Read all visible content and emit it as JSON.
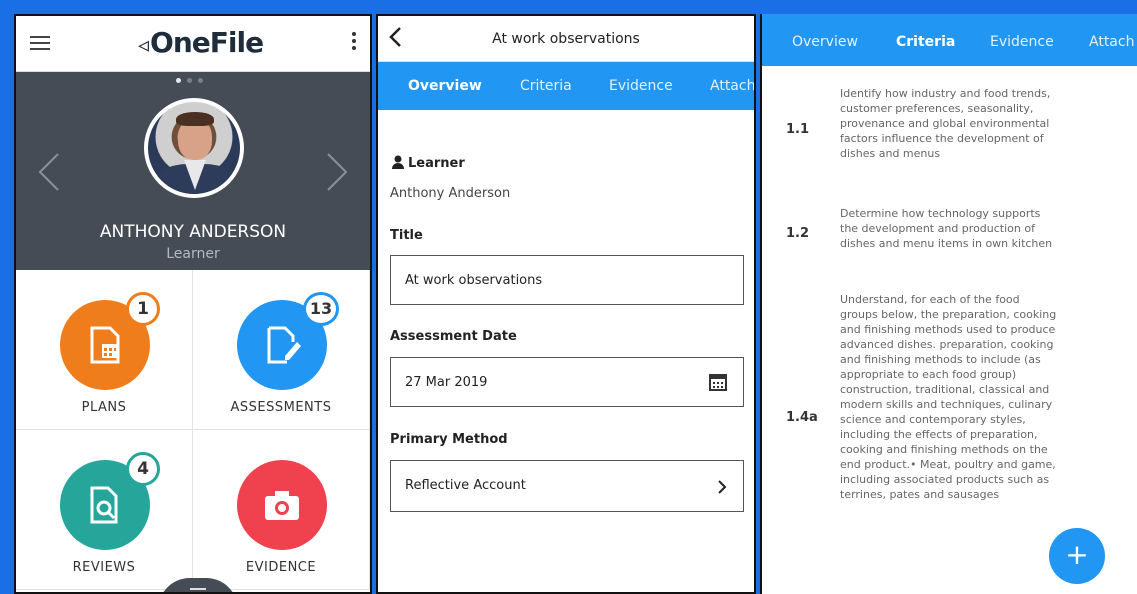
{
  "dashboard": {
    "brand": "OneFile",
    "profile": {
      "name": "ANTHONY ANDERSON",
      "role": "Learner"
    },
    "tiles": [
      {
        "label": "PLANS",
        "badge": "1",
        "color": "#f07d1b",
        "icon": "calendar-document-icon"
      },
      {
        "label": "ASSESSMENTS",
        "badge": "13",
        "color": "#2196f3",
        "icon": "edit-document-icon"
      },
      {
        "label": "REVIEWS",
        "badge": "4",
        "color": "#26a69a",
        "icon": "search-document-icon"
      },
      {
        "label": "EVIDENCE",
        "badge": "",
        "color": "#f0424e",
        "icon": "camera-icon"
      }
    ]
  },
  "detail": {
    "title": "At work observations",
    "tabs": [
      "Overview",
      "Criteria",
      "Evidence",
      "Attach"
    ],
    "learner_label": "Learner",
    "learner_name": "Anthony Anderson",
    "title_label": "Title",
    "title_value": "At work observations",
    "date_label": "Assessment Date",
    "date_value": "27 Mar 2019",
    "method_label": "Primary Method",
    "method_value": "Reflective Account"
  },
  "criteria": {
    "tabs": [
      "Overview",
      "Criteria",
      "Evidence",
      "Attach"
    ],
    "items": [
      {
        "id": "1.1",
        "lines": [
          "Identify how industry and food trends,",
          "customer preferences, seasonality,",
          "provenance and global environmental",
          "factors influence the development of",
          "dishes and menus"
        ]
      },
      {
        "id": "1.2",
        "lines": [
          "Determine how technology supports",
          "the development and production of",
          "dishes and menu items in own kitchen"
        ]
      },
      {
        "id": "1.4a",
        "lines": [
          "Understand, for each of the food",
          "groups below, the preparation, cooking",
          "and finishing methods used to produce",
          "advanced dishes. preparation, cooking",
          "and finishing methods to include (as",
          "appropriate to each food group)",
          "construction, traditional, classical and",
          "modern skills and techniques, culinary",
          "science and contemporary styles,",
          "including the effects of preparation,",
          "cooking and finishing methods on the",
          "end product.• Meat, poultry and game,",
          "including associated products such as",
          "terrines, pates and sausages"
        ]
      }
    ],
    "fab": "+"
  }
}
